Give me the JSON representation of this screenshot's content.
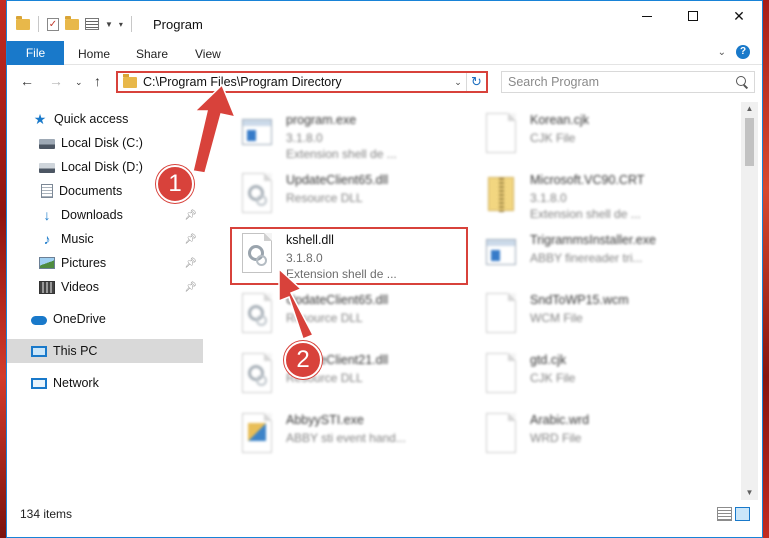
{
  "window": {
    "title": "Program"
  },
  "ribbon": {
    "tabs": [
      "File",
      "Home",
      "Share",
      "View"
    ]
  },
  "address_bar": {
    "path": "C:\\Program Files\\Program Directory"
  },
  "search": {
    "placeholder": "Search Program"
  },
  "sidebar": {
    "items": [
      {
        "label": "Quick access",
        "icon": "star-icon",
        "pinned": false
      },
      {
        "label": "Local Disk (C:)",
        "icon": "disk-icon",
        "pinned": false
      },
      {
        "label": "Local Disk (D:)",
        "icon": "disk-icon",
        "pinned": false
      },
      {
        "label": "Documents",
        "icon": "document-icon",
        "pinned": false
      },
      {
        "label": "Downloads",
        "icon": "download-icon",
        "pinned": true
      },
      {
        "label": "Music",
        "icon": "music-icon",
        "pinned": true
      },
      {
        "label": "Pictures",
        "icon": "pictures-icon",
        "pinned": true
      },
      {
        "label": "Videos",
        "icon": "videos-icon",
        "pinned": true
      },
      {
        "label": "OneDrive",
        "icon": "cloud-icon",
        "pinned": false
      },
      {
        "label": "This PC",
        "icon": "computer-icon",
        "pinned": false,
        "selected": true
      },
      {
        "label": "Network",
        "icon": "network-icon",
        "pinned": false
      }
    ]
  },
  "files": [
    {
      "name": "program.exe",
      "line1": "3.1.8.0",
      "line2": "Extension shell de ...",
      "icon": "exe-icon"
    },
    {
      "name": "Korean.cjk",
      "line1": "CJK File",
      "line2": "",
      "icon": "page-icon"
    },
    {
      "name": "UpdateClient65.dll",
      "line1": "Resource DLL",
      "line2": "",
      "icon": "dll-gear-icon"
    },
    {
      "name": "Microsoft.VC90.CRT",
      "line1": "3.1.8.0",
      "line2": "Extension shell de ...",
      "icon": "folder-zip-icon"
    },
    {
      "name": "kshell.dll",
      "line1": "3.1.8.0",
      "line2": "Extension shell de ...",
      "icon": "dll-gear-icon"
    },
    {
      "name": "TrigrammsInstaller.exe",
      "line1": "ABBY finereader tri...",
      "line2": "",
      "icon": "exe-icon"
    },
    {
      "name": "UpdateClient65.dll",
      "line1": "Resource DLL",
      "line2": "",
      "icon": "dll-gear-icon"
    },
    {
      "name": "SndToWP15.wcm",
      "line1": "WCM File",
      "line2": "",
      "icon": "page-icon"
    },
    {
      "name": "UpdateClient21.dll",
      "line1": "Resource DLL",
      "line2": "",
      "icon": "dll-gear-icon"
    },
    {
      "name": "gtd.cjk",
      "line1": "CJK File",
      "line2": "",
      "icon": "page-icon"
    },
    {
      "name": "AbbyySTI.exe",
      "line1": "ABBY sti event hand...",
      "line2": "",
      "icon": "exe-icon"
    },
    {
      "name": "Arabic.wrd",
      "line1": "WRD File",
      "line2": "",
      "icon": "page-icon"
    }
  ],
  "callouts": {
    "one": "1",
    "two": "2"
  },
  "status": {
    "item_count": "134 items"
  },
  "colors": {
    "accent": "#1979ca",
    "highlight": "#d8423b"
  }
}
